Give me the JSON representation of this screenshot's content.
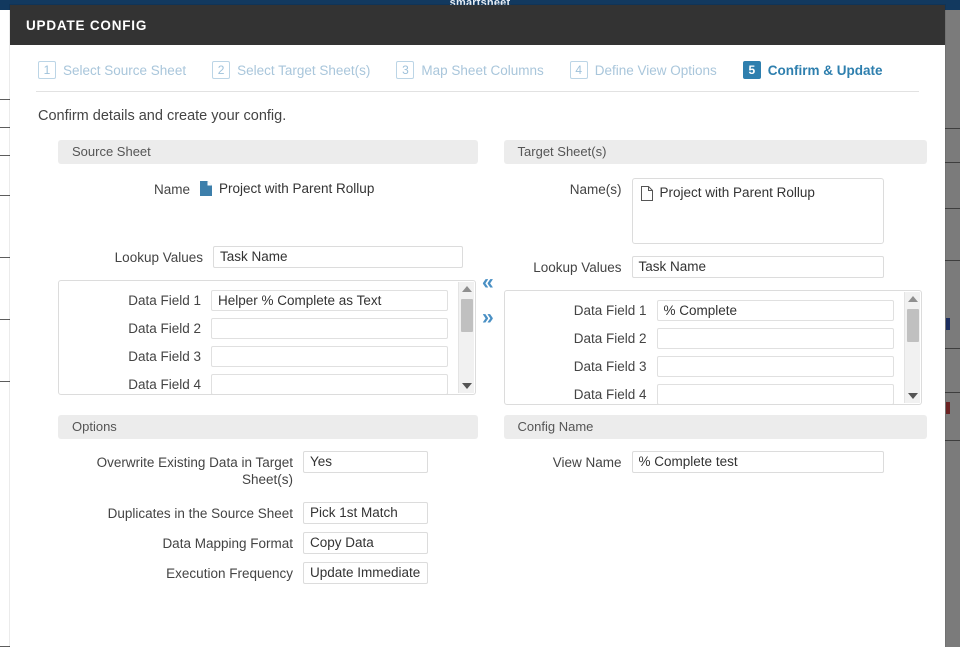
{
  "background": {
    "brand": "smartsheet"
  },
  "modal": {
    "title": "UPDATE CONFIG",
    "intro": "Confirm details and create your config.",
    "accent_color": "#2e7fae",
    "header_color": "#333333"
  },
  "stepper": {
    "steps": [
      {
        "num": "1",
        "label": "Select Source Sheet",
        "state": "pending"
      },
      {
        "num": "2",
        "label": "Select Target Sheet(s)",
        "state": "pending"
      },
      {
        "num": "3",
        "label": "Map Sheet Columns",
        "state": "pending"
      },
      {
        "num": "4",
        "label": "Define View Options",
        "state": "pending"
      },
      {
        "num": "5",
        "label": "Confirm & Update",
        "state": "active"
      }
    ]
  },
  "source_panel": {
    "heading": "Source Sheet",
    "name_label": "Name",
    "name_value": "Project with Parent Rollup",
    "name_icon": "document-filled-icon",
    "lookup_label": "Lookup Values",
    "lookup_value": "Task Name",
    "data_fields": [
      {
        "label": "Data Field 1",
        "value": "Helper % Complete as Text"
      },
      {
        "label": "Data Field 2",
        "value": ""
      },
      {
        "label": "Data Field 3",
        "value": ""
      },
      {
        "label": "Data Field 4",
        "value": ""
      }
    ]
  },
  "target_panel": {
    "heading": "Target Sheet(s)",
    "name_label": "Name(s)",
    "name_value": "Project with Parent Rollup",
    "name_icon": "document-outline-icon",
    "lookup_label": "Lookup Values",
    "lookup_value": "Task Name",
    "data_fields": [
      {
        "label": "Data Field 1",
        "value": "% Complete"
      },
      {
        "label": "Data Field 2",
        "value": ""
      },
      {
        "label": "Data Field 3",
        "value": ""
      },
      {
        "label": "Data Field 4",
        "value": ""
      }
    ]
  },
  "transfer": {
    "left_icon": "chevron-double-left-icon",
    "left_glyph": "«",
    "right_icon": "chevron-double-right-icon",
    "right_glyph": "»"
  },
  "options_panel": {
    "heading": "Options",
    "rows": [
      {
        "label": "Overwrite Existing Data in Target Sheet(s)",
        "value": "Yes"
      },
      {
        "label": "Duplicates in the Source Sheet",
        "value": "Pick 1st Match"
      },
      {
        "label": "Data Mapping Format",
        "value": "Copy Data"
      },
      {
        "label": "Execution Frequency",
        "value": "Update Immediate"
      }
    ]
  },
  "config_panel": {
    "heading": "Config Name",
    "view_name_label": "View Name",
    "view_name_value": "% Complete test"
  }
}
